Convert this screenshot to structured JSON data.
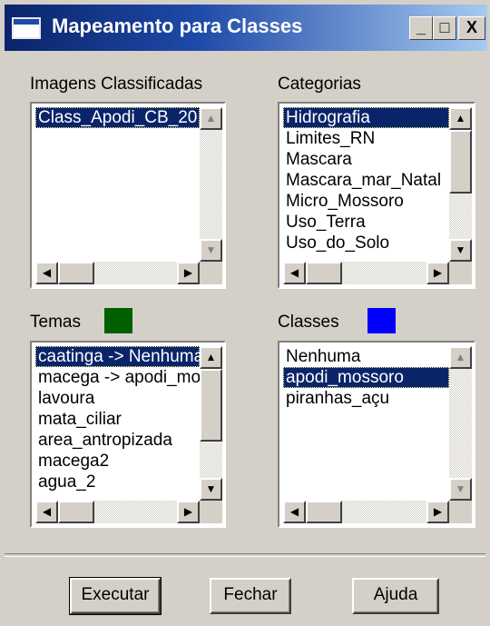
{
  "window": {
    "title": "Mapeamento para Classes",
    "controls": {
      "minimize": "_",
      "maximize": "□",
      "close": "X"
    }
  },
  "images": {
    "label": "Imagens Classificadas",
    "items": [
      "Class_Apodi_CB_20"
    ],
    "selected_index": 0
  },
  "categories": {
    "label": "Categorias",
    "items": [
      "Hidrografia",
      "Limites_RN",
      "Mascara",
      "Mascara_mar_Natal",
      "Micro_Mossoro",
      "Uso_Terra",
      "Uso_do_Solo"
    ],
    "selected_index": 0
  },
  "themes": {
    "label": "Temas",
    "color": "#006000",
    "items": [
      "caatinga -> Nenhuma",
      "macega -> apodi_mossoro",
      "lavoura",
      "mata_ciliar",
      "area_antropizada",
      "macega2",
      "agua_2"
    ],
    "selected_index": 0
  },
  "classes": {
    "label": "Classes",
    "color": "#0000ff",
    "items": [
      "Nenhuma",
      "apodi_mossoro",
      "piranhas_açu"
    ],
    "selected_index": 1
  },
  "buttons": {
    "execute": "Executar",
    "close": "Fechar",
    "help": "Ajuda"
  },
  "icons": {
    "arrow_up": "▲",
    "arrow_down": "▼",
    "arrow_left": "◀",
    "arrow_right": "▶"
  }
}
